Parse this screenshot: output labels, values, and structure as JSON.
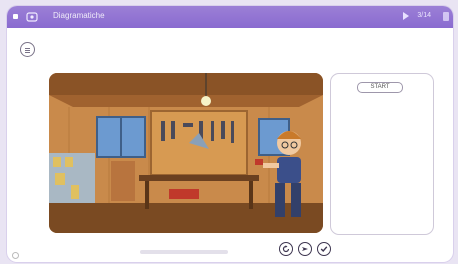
{
  "window": {
    "title": "Diagramatiche",
    "counter": "3/14"
  },
  "icons": {
    "menu": "menu-icon",
    "play": "play-icon",
    "restart": "restart-icon",
    "hint": "hint-arrow-icon",
    "check": "check-icon"
  },
  "panel": {
    "start_label": "START"
  },
  "progress": {
    "value": 0.0
  },
  "colors": {
    "titlebar": "#8a6bd0",
    "accent": "#3d3550",
    "panel_border": "#cfc9d9"
  }
}
